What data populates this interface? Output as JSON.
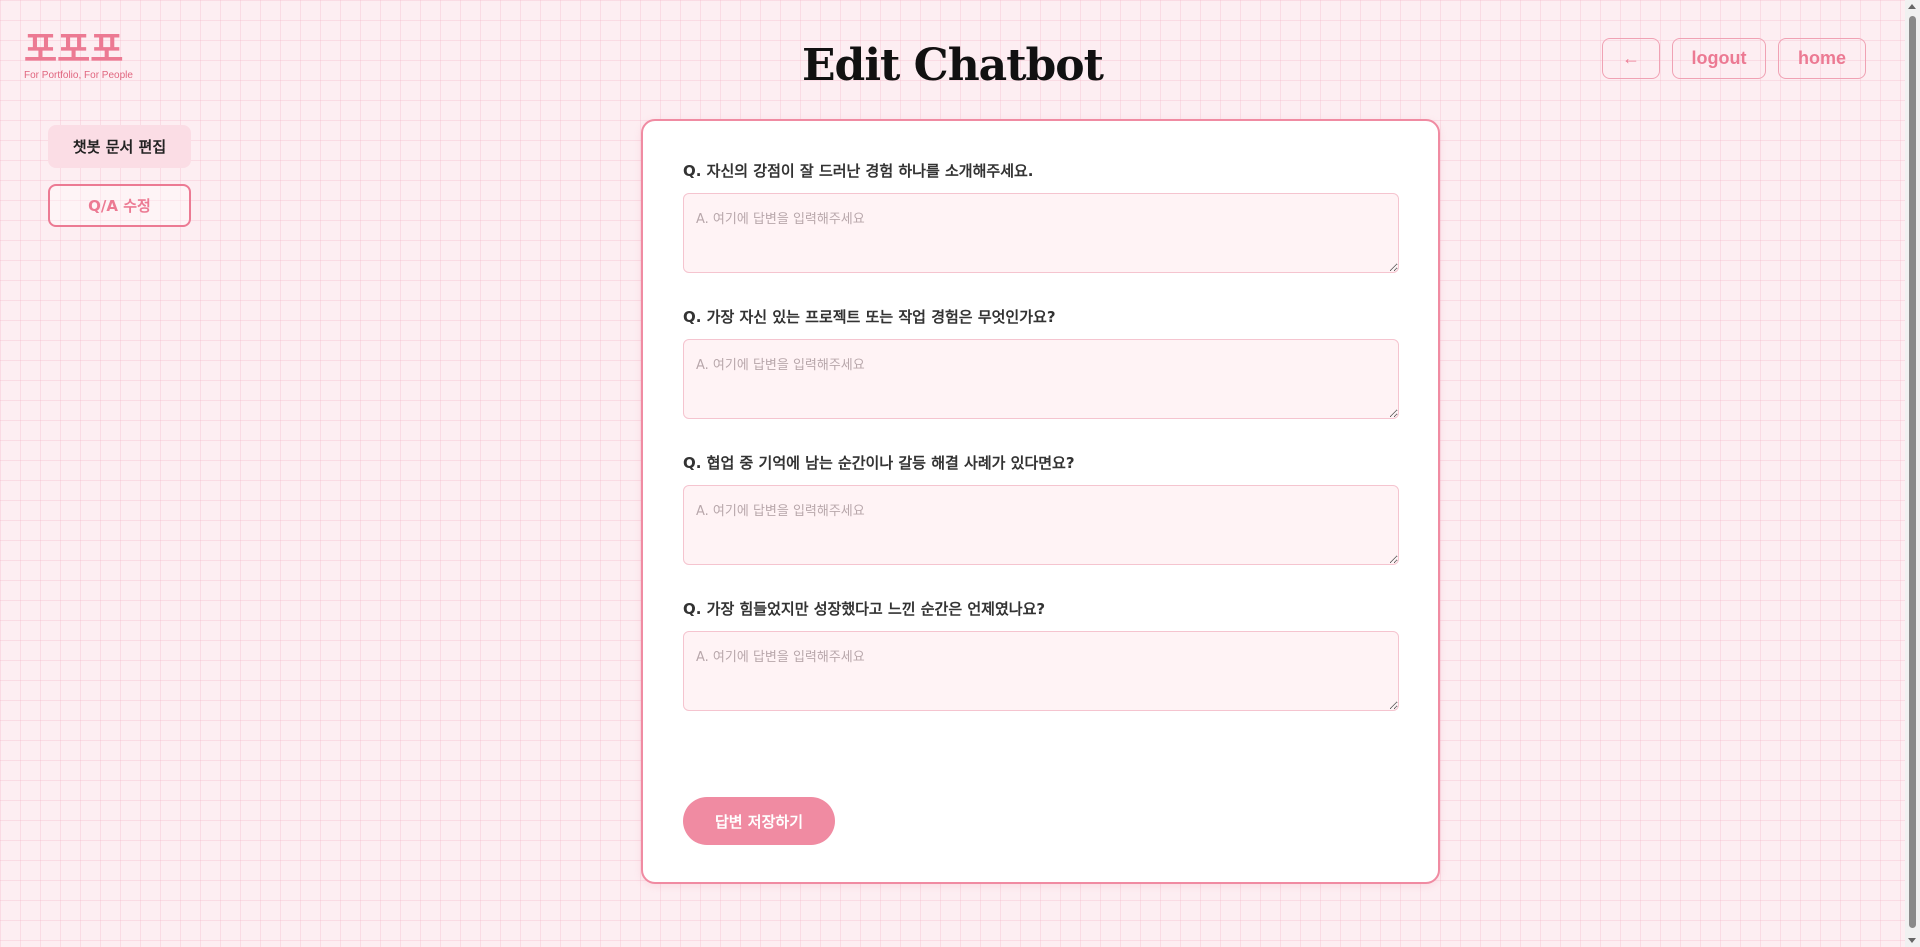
{
  "logo": {
    "mark": "포포포",
    "tagline": "For Portfolio, For People"
  },
  "header": {
    "title": "Edit Chatbot",
    "back_label": "←",
    "logout_label": "logout",
    "home_label": "home"
  },
  "sidebar": {
    "items": [
      {
        "label": "챗봇 문서 편집",
        "active": true
      },
      {
        "label": "Q/A 수정",
        "active": false
      }
    ]
  },
  "form": {
    "questions": [
      {
        "label": "Q. 자신의 강점이 잘 드러난 경험 하나를 소개해주세요.",
        "value": "",
        "placeholder": "A. 여기에 답변을 입력해주세요"
      },
      {
        "label": "Q. 가장 자신 있는 프로젝트 또는 작업 경험은 무엇인가요?",
        "value": "",
        "placeholder": "A. 여기에 답변을 입력해주세요"
      },
      {
        "label": "Q. 협업 중 기억에 남는 순간이나 갈등 해결 사례가 있다면요?",
        "value": "",
        "placeholder": "A. 여기에 답변을 입력해주세요"
      },
      {
        "label": "Q. 가장 힘들었지만 성장했다고 느낀 순간은 언제였나요?",
        "value": "",
        "placeholder": "A. 여기에 답변을 입력해주세요"
      }
    ],
    "save_label": "답변 저장하기"
  },
  "colors": {
    "accent": "#ec7a93",
    "background": "#fdeef2",
    "button": "#f08ba2"
  }
}
